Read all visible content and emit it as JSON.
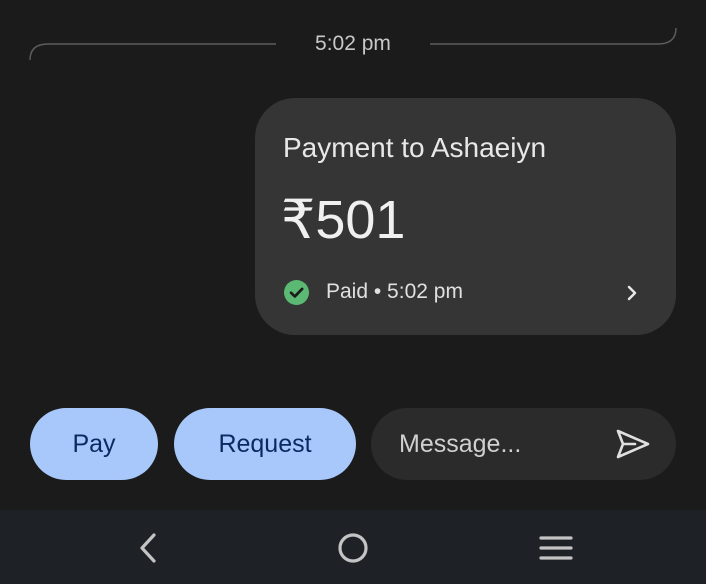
{
  "conversation": {
    "timestamp": "5:02 pm"
  },
  "payment_card": {
    "title": "Payment to Ashaeiyn",
    "amount": "₹501",
    "status": "Paid • 5:02 pm",
    "status_icon": "check-circle-icon",
    "status_color": "#5bb974",
    "chevron_icon": "chevron-right-icon"
  },
  "actions": {
    "pay_label": "Pay",
    "request_label": "Request"
  },
  "composer": {
    "placeholder": "Message...",
    "value": "",
    "send_icon": "send-icon"
  },
  "nav_bar": {
    "back_icon": "back-icon",
    "home_icon": "home-icon",
    "recents_icon": "recents-icon"
  },
  "colors": {
    "background": "#1b1b1b",
    "card": "#353535",
    "button_fill": "#a8c7fa",
    "button_text": "#0b2b60",
    "composer": "#2b2b2b",
    "nav_bar": "#1e2125"
  }
}
